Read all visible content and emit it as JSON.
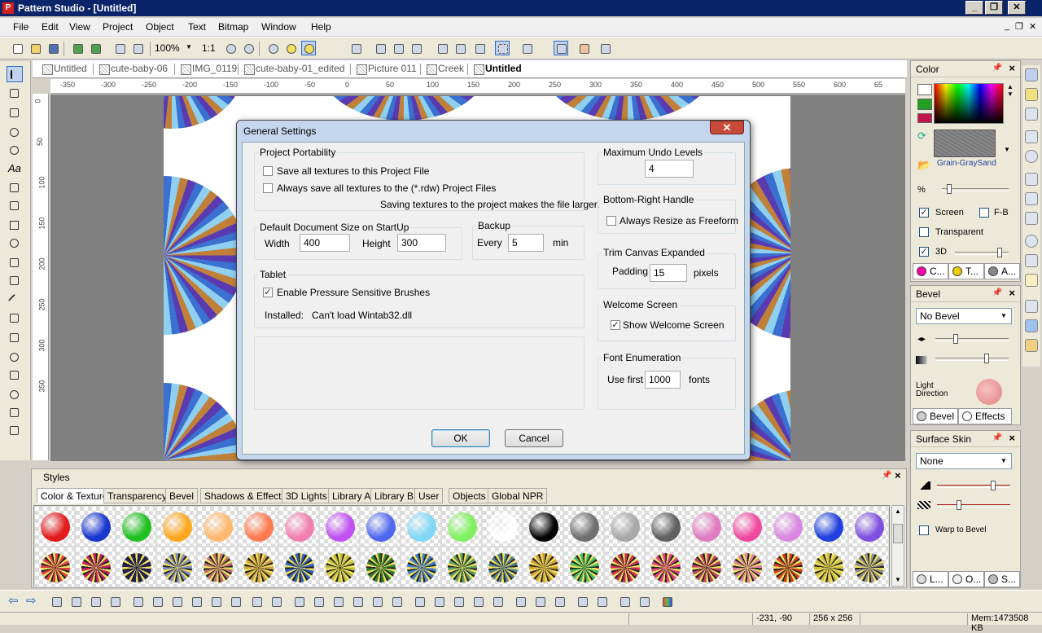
{
  "app": {
    "title": "Pattern Studio - [Untitled]",
    "icon": "P"
  },
  "window_controls": {
    "minimize": "_",
    "restore": "❐",
    "close": "✕"
  },
  "menu": [
    "File",
    "Edit",
    "View",
    "Project",
    "Object",
    "Text",
    "Bitmap",
    "Window",
    "Help"
  ],
  "toolbar": {
    "zoom": "100%",
    "ratio": "1:1"
  },
  "doc_tabs": [
    "Untitled",
    "cute-baby-06",
    "IMG_0119",
    "cute-baby-01_edited",
    "Picture 011",
    "Creek",
    "Untitled"
  ],
  "hruler_ticks": [
    "-350",
    "-300",
    "-250",
    "-200",
    "-150",
    "-100",
    "-50",
    "0",
    "50",
    "100",
    "150",
    "200",
    "250",
    "300",
    "350",
    "400",
    "450",
    "500",
    "550",
    "600",
    "65"
  ],
  "vruler_ticks": [
    "0",
    "50",
    "100",
    "150",
    "200",
    "250",
    "300",
    "350"
  ],
  "color_panel": {
    "title": "Color",
    "texture_name": "Grain-GraySand",
    "percent_label": "%",
    "screen_label": "Screen",
    "fb_label": "F-B",
    "transparent_label": "Transparent",
    "threed_label": "3D",
    "tabs": [
      "C...",
      "T...",
      "A..."
    ],
    "colors": {
      "top": "#ffffff",
      "mid": "#22a022",
      "bottom": "#c0144a"
    }
  },
  "bevel_panel": {
    "title": "Bevel",
    "selected": "No Bevel",
    "light_label": "Light Direction",
    "tabs": [
      "Bevel",
      "Effects"
    ]
  },
  "surface_panel": {
    "title": "Surface Skin",
    "selected": "None",
    "warp_label": "Warp to Bevel",
    "tabs": [
      "L...",
      "O...",
      "S..."
    ]
  },
  "styles_panel": {
    "title": "Styles",
    "tabs": [
      "Color & Texture",
      "Transparency",
      "Bevel",
      "Shadows & Effects",
      "3D Lights",
      "Library A",
      "Library B",
      "User",
      "Objects",
      "Global NPR"
    ],
    "row1": [
      "#e21c1c",
      "#1a35d0",
      "#20c020",
      "#ffa820",
      "#ffb870",
      "#ff7a50",
      "#f080b0",
      "#c050f0",
      "#5068f0",
      "#80d8f8",
      "#80f060",
      "#ffffff",
      "#050505",
      "#707070",
      "#a8a8a8",
      "#606060",
      "#e07cc0",
      "#f04aa0",
      "#d888e0",
      "#2040e0",
      "#8050e0"
    ],
    "row2": [
      "#e04040",
      "#c02060",
      "#202060",
      "#8090c0",
      "#c07070",
      "#d0a040",
      "#3060c0",
      "#c0c040",
      "#308030",
      "#4080d0",
      "#60a060",
      "#508090",
      "#d0a030",
      "#40c060",
      "#d03050",
      "#e04080",
      "#c04060",
      "#e080a0",
      "#d04020",
      "#d0c040",
      "#909090"
    ]
  },
  "dialog": {
    "title": "General Settings",
    "close": "✕",
    "portability": {
      "title": "Project Portability",
      "save_all": "Save all textures to this Project File",
      "always_save": "Always save all textures to the (*.rdw) Project Files",
      "note": "Saving textures to the project makes the file larger."
    },
    "doc_size": {
      "title": "Default Document Size on StartUp",
      "width_label": "Width",
      "width": "400",
      "height_label": "Height",
      "height": "300"
    },
    "backup": {
      "title": "Backup",
      "every_label": "Every",
      "value": "5",
      "unit": "min"
    },
    "tablet": {
      "title": "Tablet",
      "enable": "Enable Pressure Sensitive Brushes",
      "installed_label": "Installed:",
      "installed_value": "Can't load Wintab32.dll"
    },
    "undo": {
      "title": "Maximum Undo Levels",
      "value": "4"
    },
    "handle": {
      "title": "Bottom-Right Handle",
      "option": "Always Resize as Freeform"
    },
    "trim": {
      "title": "Trim Canvas Expanded",
      "padding_label": "Padding",
      "value": "15",
      "unit": "pixels"
    },
    "welcome": {
      "title": "Welcome Screen",
      "option": "Show Welcome Screen"
    },
    "fonts": {
      "title": "Font Enumeration",
      "use_first": "Use first",
      "value": "1000",
      "unit": "fonts"
    },
    "ok": "OK",
    "cancel": "Cancel"
  },
  "status": {
    "coords": "-231, -90",
    "size": "256 x 256",
    "mem": "Mem:1473508 KB"
  }
}
